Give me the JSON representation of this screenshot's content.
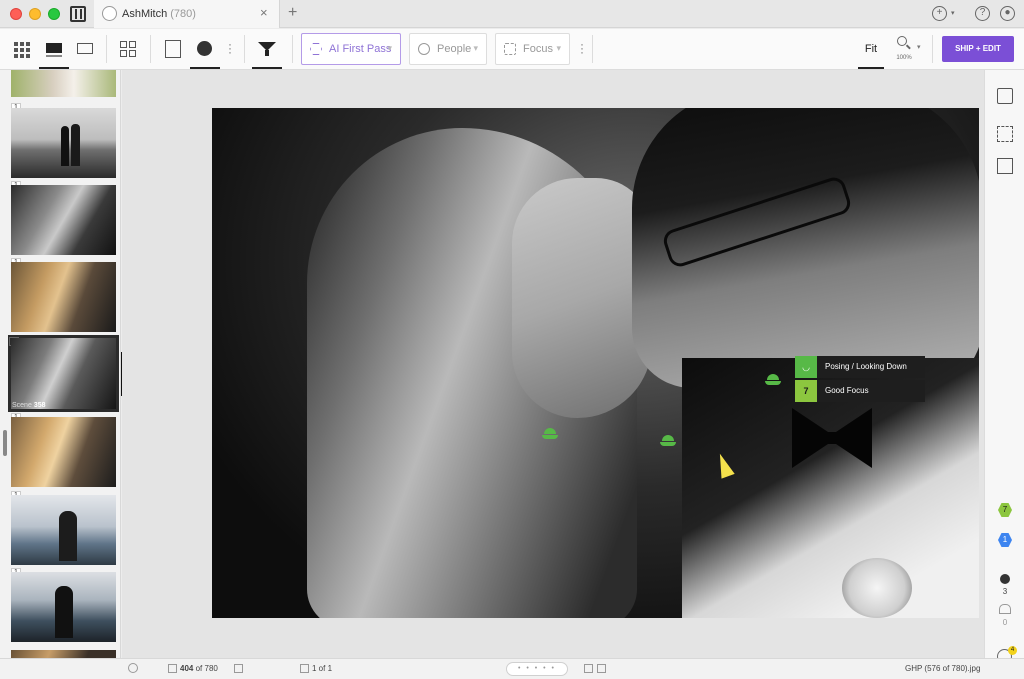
{
  "window": {
    "tab_title": "AshMitch",
    "tab_count": "(780)",
    "tab_close": "×",
    "tab_add": "+"
  },
  "toolbar": {
    "filters": [
      {
        "label": "AI First Pass",
        "active": true
      },
      {
        "label": "People",
        "active": false
      },
      {
        "label": "Focus",
        "active": false
      }
    ],
    "fit_label": "Fit",
    "zoom_label": "100%",
    "ship_label": "SHIP + EDIT"
  },
  "filmstrip": {
    "items": [
      {
        "badge": "1",
        "tone": "light"
      },
      {
        "badge": "1",
        "tone": "bw-beach"
      },
      {
        "badge": "1",
        "tone": "bw-couple"
      },
      {
        "badge": "1",
        "tone": "warm-couple"
      },
      {
        "badge": "1",
        "tone": "bw-couple",
        "selected": true,
        "scene_prefix": "Scene",
        "scene_number": "358"
      },
      {
        "badge": "1",
        "tone": "warm-couple"
      },
      {
        "badge": "1",
        "tone": "sea"
      },
      {
        "badge": "1",
        "tone": "sea-dark"
      },
      {
        "badge": "",
        "tone": "warm-couple"
      }
    ],
    "flyout_tag": "1"
  },
  "photo": {
    "tags": [
      {
        "icon": "eye-closed-icon",
        "text": "Posing / Looking Down"
      },
      {
        "icon": "7",
        "text": "Good Focus"
      }
    ]
  },
  "right_rail": {
    "focus_badge": "7",
    "blue_badge": "1",
    "people_count": "3",
    "group_count": "0",
    "notif_count": "4"
  },
  "statusbar": {
    "image_index": "404",
    "image_total_prefix": "of 780",
    "page_current": "1 of 1",
    "filename": "GHP (576 of 780).jpg"
  },
  "colors": {
    "accent_purple": "#7b4fd6",
    "face_green": "#57b947",
    "focus_green": "#8cc63f",
    "badge_blue": "#3d85f0"
  }
}
